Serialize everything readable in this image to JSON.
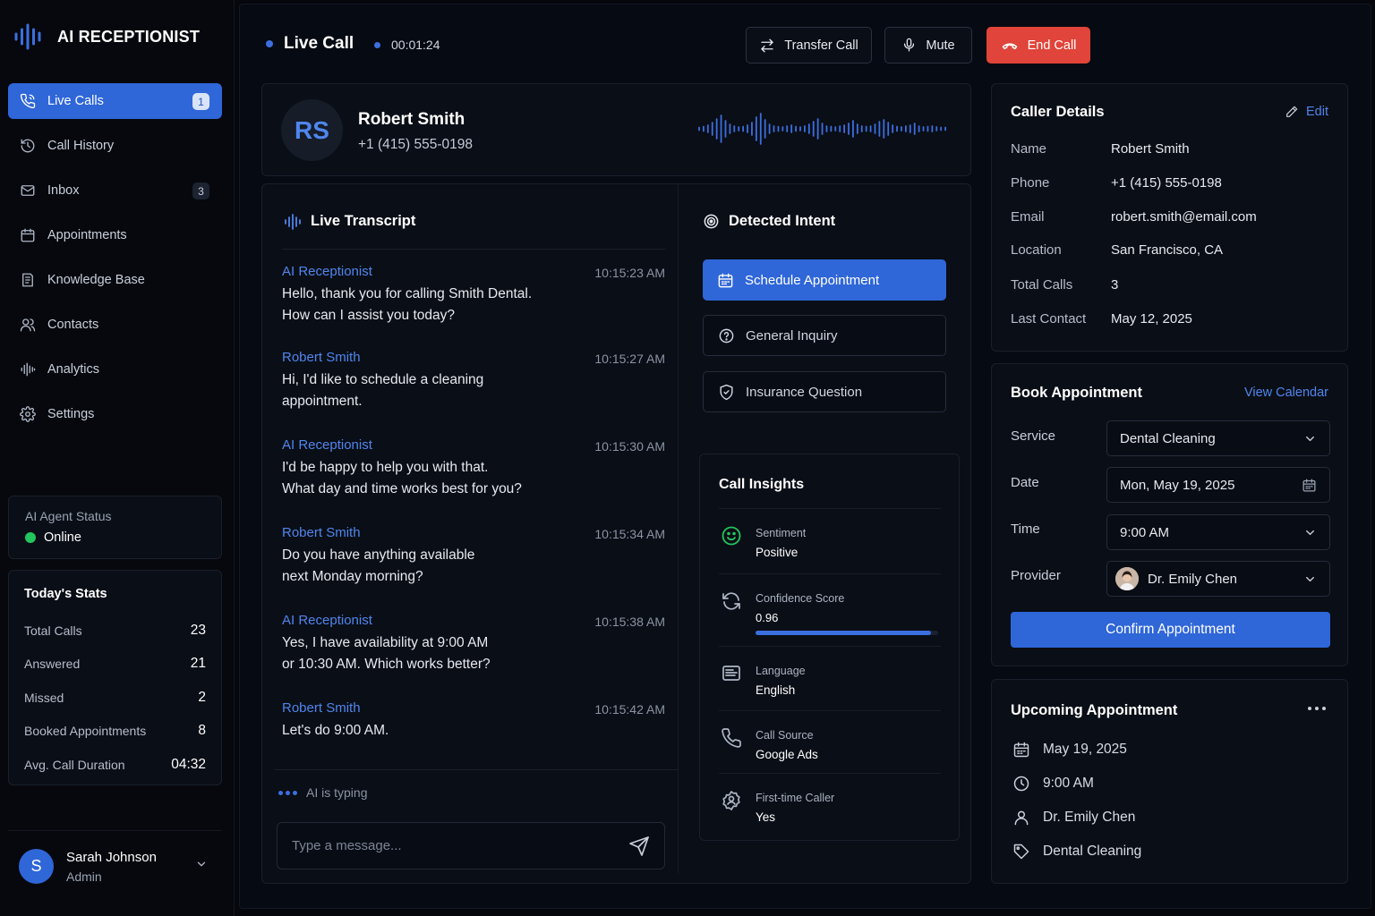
{
  "app": {
    "title": "AI RECEPTIONIST"
  },
  "nav": {
    "items": [
      {
        "label": "Live Calls",
        "badge": "1"
      },
      {
        "label": "Call History"
      },
      {
        "label": "Inbox",
        "badge": "3"
      },
      {
        "label": "Appointments"
      },
      {
        "label": "Knowledge Base"
      },
      {
        "label": "Contacts"
      },
      {
        "label": "Analytics"
      },
      {
        "label": "Settings"
      }
    ]
  },
  "agent_status": {
    "label": "AI Agent Status",
    "value": "Online"
  },
  "stats": {
    "title": "Today's Stats",
    "rows": [
      {
        "label": "Total Calls",
        "value": "23"
      },
      {
        "label": "Answered",
        "value": "21"
      },
      {
        "label": "Missed",
        "value": "2"
      },
      {
        "label": "Booked Appointments",
        "value": "8"
      },
      {
        "label": "Avg. Call Duration",
        "value": "04:32"
      }
    ]
  },
  "user": {
    "initial": "S",
    "name": "Sarah Johnson",
    "role": "Admin"
  },
  "topbar": {
    "title": "Live Call",
    "timer": "00:01:24",
    "transfer_label": "Transfer Call",
    "mute_label": "Mute",
    "end_label": "End Call"
  },
  "caller": {
    "initials": "RS",
    "name": "Robert Smith",
    "phone": "+1 (415) 555-0198"
  },
  "transcript": {
    "title": "Live Transcript",
    "messages": [
      {
        "who": "AI Receptionist",
        "time": "10:15:23 AM",
        "lines": [
          "Hello, thank you for calling Smith Dental.",
          "How can I assist you today?"
        ]
      },
      {
        "who": "Robert Smith",
        "time": "10:15:27 AM",
        "lines": [
          "Hi, I'd like to schedule a cleaning",
          "appointment."
        ]
      },
      {
        "who": "AI Receptionist",
        "time": "10:15:30 AM",
        "lines": [
          "I'd be happy to help you with that.",
          "What day and time works best for you?"
        ]
      },
      {
        "who": "Robert Smith",
        "time": "10:15:34 AM",
        "lines": [
          "Do you have anything available",
          "next Monday morning?"
        ]
      },
      {
        "who": "AI Receptionist",
        "time": "10:15:38 AM",
        "lines": [
          "Yes, I have availability at 9:00 AM",
          "or 10:30 AM. Which works better?"
        ]
      },
      {
        "who": "Robert Smith",
        "time": "10:15:42 AM",
        "lines": [
          "Let's do 9:00 AM."
        ]
      }
    ],
    "typing": "AI is typing",
    "input_placeholder": "Type a message..."
  },
  "intent": {
    "title": "Detected Intent",
    "options": [
      "Schedule Appointment",
      "General Inquiry",
      "Insurance Question"
    ],
    "selected": "Schedule Appointment"
  },
  "insights": {
    "title": "Call Insights",
    "items": [
      {
        "label": "Sentiment",
        "value": "Positive",
        "icon": "smile-icon"
      },
      {
        "label": "Confidence Score",
        "value": "0.96",
        "icon": "refresh-icon",
        "progress": 0.96
      },
      {
        "label": "Language",
        "value": "English",
        "icon": "language-icon"
      },
      {
        "label": "Call Source",
        "value": "Google Ads",
        "icon": "phone-icon"
      },
      {
        "label": "First-time Caller",
        "value": "Yes",
        "icon": "badge-icon"
      }
    ]
  },
  "caller_details": {
    "title": "Caller Details",
    "edit_label": "Edit",
    "rows": [
      {
        "label": "Name",
        "value": "Robert Smith"
      },
      {
        "label": "Phone",
        "value": "+1 (415) 555-0198"
      },
      {
        "label": "Email",
        "value": "robert.smith@email.com"
      },
      {
        "label": "Location",
        "value": "San Francisco, CA"
      },
      {
        "label": "Total Calls",
        "value": "3"
      },
      {
        "label": "Last Contact",
        "value": "May 12, 2025"
      }
    ]
  },
  "booking": {
    "title": "Book Appointment",
    "view_calendar_label": "View Calendar",
    "service_label": "Service",
    "service_value": "Dental Cleaning",
    "date_label": "Date",
    "date_value": "Mon, May 19, 2025",
    "time_label": "Time",
    "time_value": "9:00 AM",
    "provider_label": "Provider",
    "provider_value": "Dr. Emily Chen",
    "confirm_label": "Confirm Appointment"
  },
  "upcoming": {
    "title": "Upcoming Appointment",
    "date": "May 19, 2025",
    "time": "9:00 AM",
    "provider": "Dr. Emily Chen",
    "service": "Dental Cleaning"
  },
  "colors": {
    "accent": "#2f66d8",
    "link": "#4f86ee",
    "danger": "#e0443a",
    "online": "#22c55e",
    "background": "#05070c"
  }
}
